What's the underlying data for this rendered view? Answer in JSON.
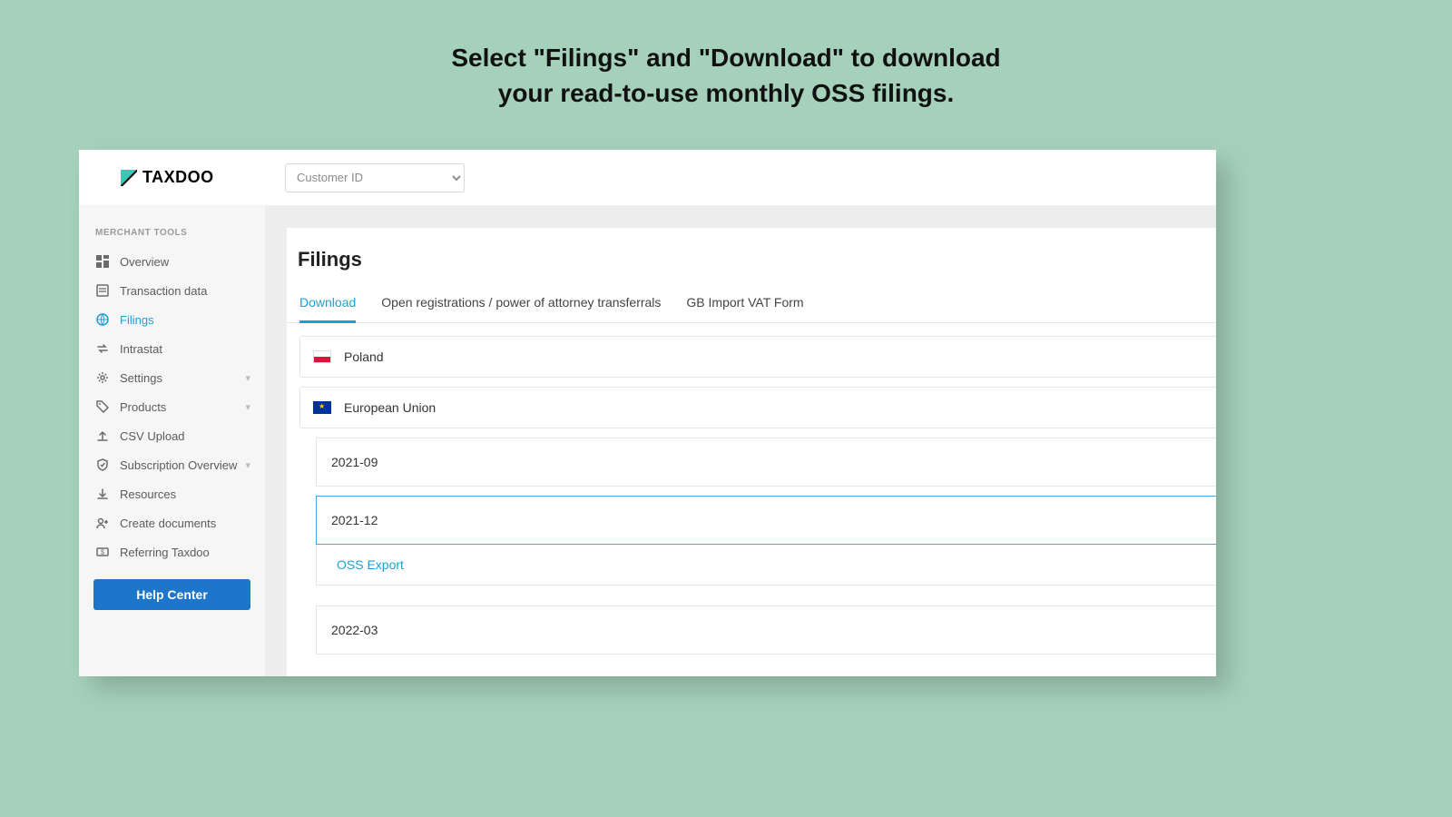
{
  "instruction": {
    "line1": "Select \"Filings\" and \"Download\" to download",
    "line2": "your read-to-use monthly OSS filings."
  },
  "brand": {
    "name": "TAXDOO"
  },
  "topbar": {
    "customer_select_label": "Customer ID"
  },
  "sidebar": {
    "heading": "MERCHANT TOOLS",
    "items": [
      {
        "label": "Overview",
        "icon": "dashboard-icon"
      },
      {
        "label": "Transaction data",
        "icon": "list-icon"
      },
      {
        "label": "Filings",
        "icon": "globe-icon"
      },
      {
        "label": "Intrastat",
        "icon": "swap-icon"
      },
      {
        "label": "Settings",
        "icon": "gear-icon"
      },
      {
        "label": "Products",
        "icon": "tag-icon"
      },
      {
        "label": "CSV Upload",
        "icon": "upload-icon"
      },
      {
        "label": "Subscription Overview",
        "icon": "shield-icon"
      },
      {
        "label": "Resources",
        "icon": "download-icon"
      },
      {
        "label": "Create documents",
        "icon": "person-plus-icon"
      },
      {
        "label": "Referring Taxdoo",
        "icon": "money-icon"
      }
    ],
    "help_label": "Help Center"
  },
  "main": {
    "title": "Filings",
    "tabs": [
      {
        "label": "Download"
      },
      {
        "label": "Open registrations / power of attorney transferrals"
      },
      {
        "label": "GB Import VAT Form"
      }
    ],
    "countries": [
      {
        "name": "Poland"
      },
      {
        "name": "European Union"
      }
    ],
    "periods": [
      {
        "label": "2021-09"
      },
      {
        "label": "2021-12"
      },
      {
        "label": "2022-03"
      }
    ],
    "export_link": "OSS Export"
  }
}
